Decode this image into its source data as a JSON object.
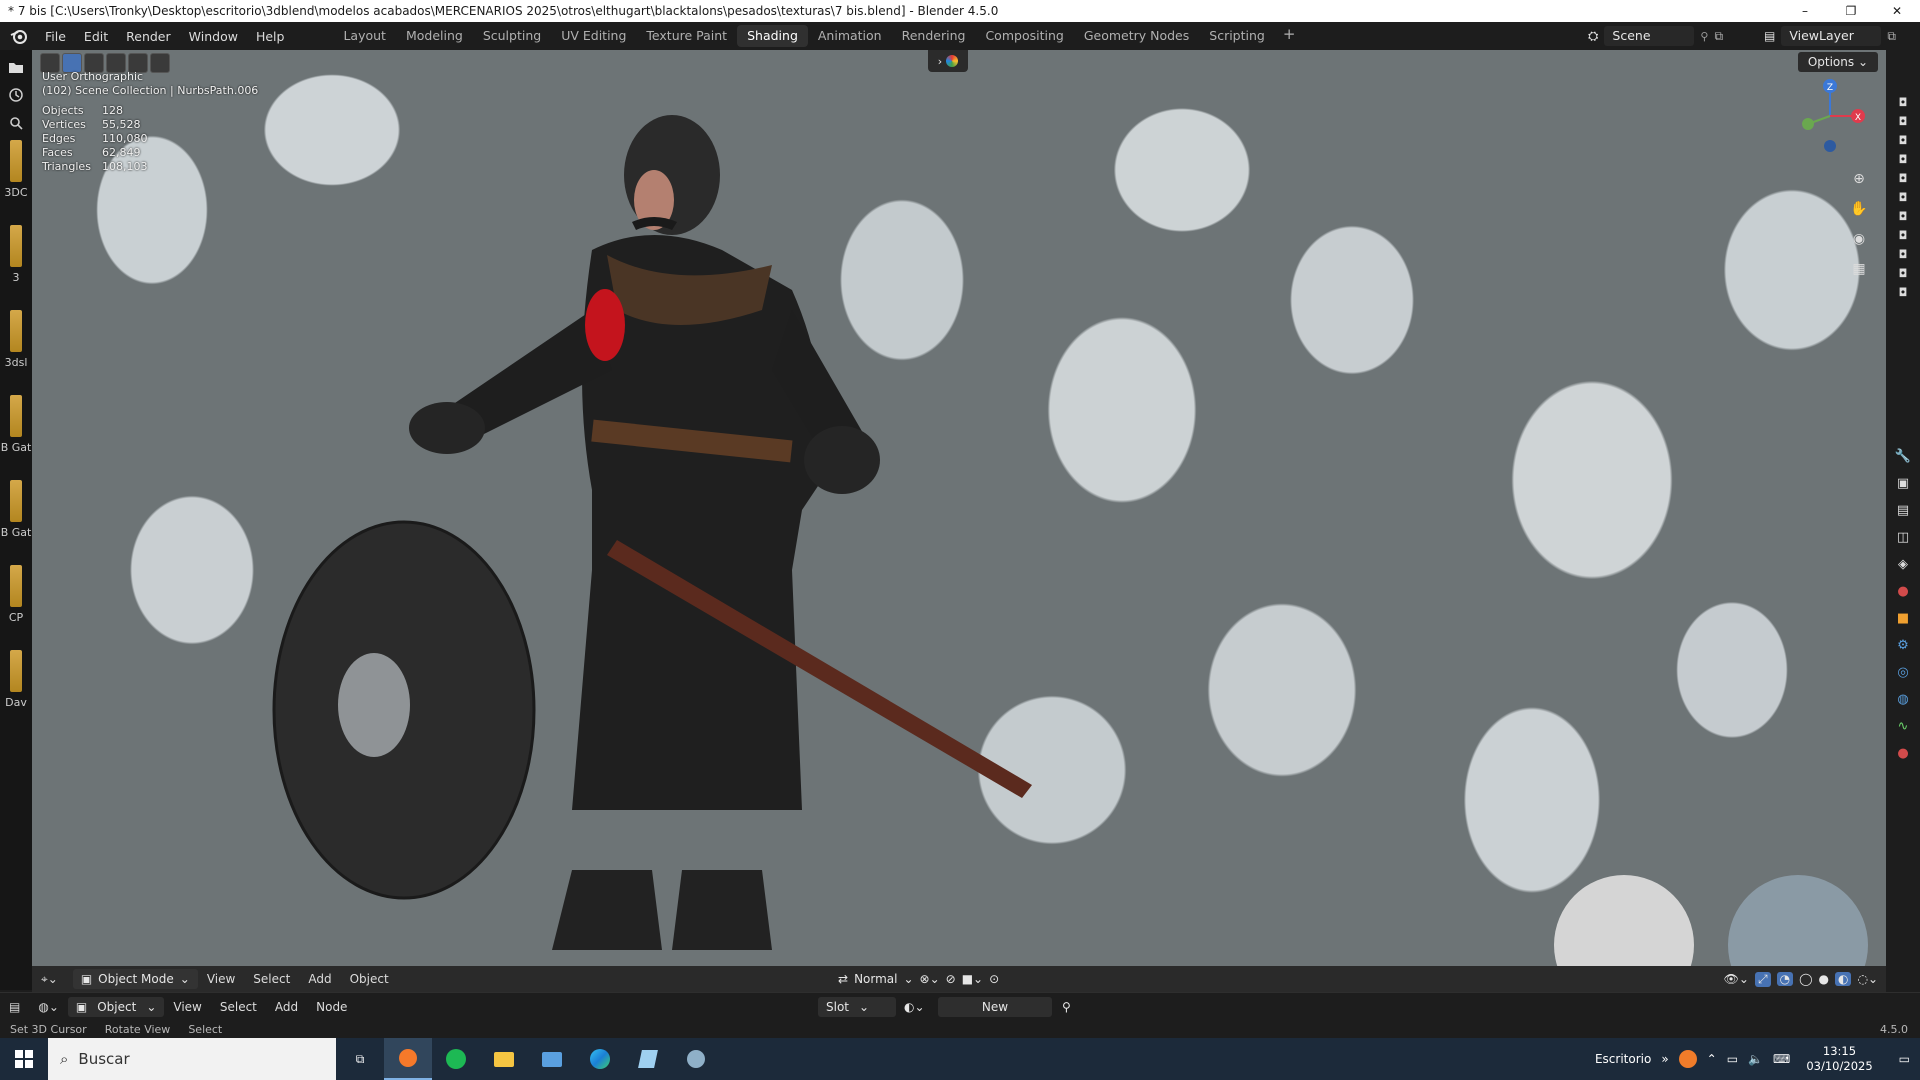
{
  "window": {
    "title": "* 7 bis [C:\\Users\\Tronky\\Desktop\\escritorio\\3dblend\\modelos acabados\\MERCENARIOS 2025\\otros\\elthugart\\blacktalons\\pesados\\texturas\\7 bis.blend] - Blender 4.5.0",
    "minimize": "–",
    "maximize": "❐",
    "close": "✕"
  },
  "menu": [
    "File",
    "Edit",
    "Render",
    "Window",
    "Help"
  ],
  "workspaces": [
    "Layout",
    "Modeling",
    "Sculpting",
    "UV Editing",
    "Texture Paint",
    "Shading",
    "Animation",
    "Rendering",
    "Compositing",
    "Geometry Nodes",
    "Scripting"
  ],
  "active_workspace": "Shading",
  "scene": "Scene",
  "view_layer": "ViewLayer",
  "viewport": {
    "view_name": "User Orthographic",
    "collection": "(102) Scene Collection | NurbsPath.006",
    "stats": [
      {
        "k": "Objects",
        "v": "128"
      },
      {
        "k": "Vertices",
        "v": "55,528"
      },
      {
        "k": "Edges",
        "v": "110,080"
      },
      {
        "k": "Faces",
        "v": "62,849"
      },
      {
        "k": "Triangles",
        "v": "108,103"
      }
    ],
    "options": "Options",
    "gizmo": {
      "z": "Z",
      "x": "X"
    }
  },
  "left_strip_labels": [
    "3DC",
    "3",
    "3dsl",
    "B Gat",
    "B Gat",
    "CP",
    "Dav"
  ],
  "viewport_toolbar": {
    "mode": "Object Mode",
    "items": [
      "View",
      "Select",
      "Add",
      "Object"
    ],
    "orientation": "Normal"
  },
  "node_editor_bar": {
    "object": "Object",
    "items": [
      "View",
      "Select",
      "Add",
      "Node"
    ],
    "slot": "Slot",
    "new": "New"
  },
  "statusbar": {
    "a": "Set 3D Cursor",
    "b": "Rotate View",
    "c": "Select",
    "version": "4.5.0"
  },
  "taskbar": {
    "search": "Buscar",
    "desktop": "Escritorio",
    "time": "13:15",
    "date": "03/10/2025"
  },
  "colors": {
    "accent": "#4772b3",
    "axis_x": "#e03b4d",
    "axis_y": "#6aa84f",
    "axis_z": "#3b78d8"
  }
}
